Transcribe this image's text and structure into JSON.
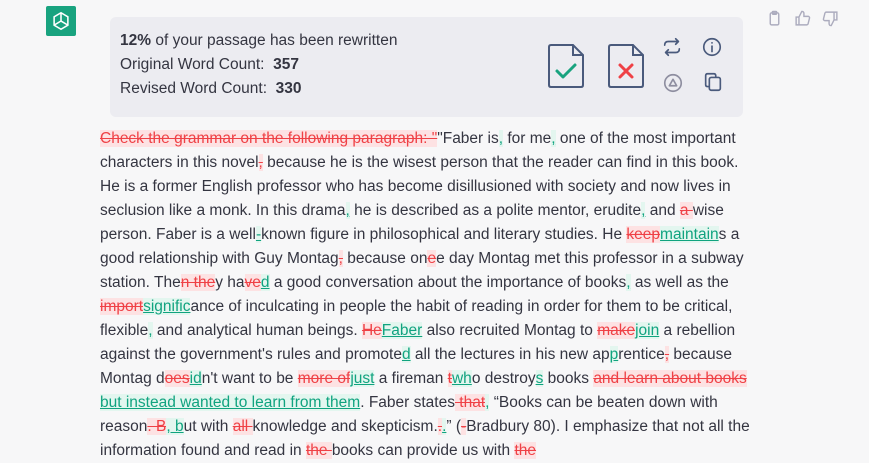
{
  "stats": {
    "percent": "12%",
    "percent_suffix": " of your passage has been rewritten",
    "original_label": "Original Word Count:",
    "original_value": "357",
    "revised_label": "Revised Word Count:",
    "revised_value": "330"
  },
  "colors": {
    "deletion": "#ef4146",
    "insertion": "#10a37f",
    "brand": "#19a37f"
  },
  "icons": [
    "chatgpt-logo-icon",
    "clipboard-icon",
    "thumbs-up-icon",
    "thumbs-down-icon",
    "accept-document-icon",
    "reject-document-icon",
    "regenerate-icon",
    "info-icon",
    "stop-icon",
    "copy-icon"
  ],
  "passage": [
    {
      "t": "del",
      "s": "Check the grammar on the following paragraph: \""
    },
    {
      "t": "txt",
      "s": "\"Faber is"
    },
    {
      "t": "ins",
      "s": ","
    },
    {
      "t": "txt",
      "s": " for me"
    },
    {
      "t": "ins",
      "s": ","
    },
    {
      "t": "txt",
      "s": " one of the most important characters in this novel"
    },
    {
      "t": "del",
      "s": ","
    },
    {
      "t": "txt",
      "s": " because he is the wisest person that the reader can find in this book. He is a former English professor who has become disillusioned with society and now lives in seclusion like a monk. In this drama"
    },
    {
      "t": "ins",
      "s": ","
    },
    {
      "t": "txt",
      "s": " he is described as a polite mentor, erudite"
    },
    {
      "t": "ins",
      "s": ","
    },
    {
      "t": "txt",
      "s": " and "
    },
    {
      "t": "del",
      "s": "a "
    },
    {
      "t": "txt",
      "s": "wise person. Faber is a well"
    },
    {
      "t": "ins",
      "s": "-"
    },
    {
      "t": "txt",
      "s": "known figure in philosophical and literary studies. He "
    },
    {
      "t": "del",
      "s": "keep"
    },
    {
      "t": "ins",
      "s": "maintain"
    },
    {
      "t": "txt",
      "s": "s a good relationship with Guy Montag"
    },
    {
      "t": "del",
      "s": ","
    },
    {
      "t": "txt",
      "s": " because on"
    },
    {
      "t": "del",
      "s": "e"
    },
    {
      "t": "txt",
      "s": "e day Montag met this professor in a subway station. The"
    },
    {
      "t": "del",
      "s": "n the"
    },
    {
      "t": "txt",
      "s": "y ha"
    },
    {
      "t": "del",
      "s": "ve"
    },
    {
      "t": "ins",
      "s": "d"
    },
    {
      "t": "txt",
      "s": " a good conversation about the importance of books"
    },
    {
      "t": "ins",
      "s": ","
    },
    {
      "t": "txt",
      "s": " as well as the "
    },
    {
      "t": "del",
      "s": "import"
    },
    {
      "t": "ins",
      "s": "signific"
    },
    {
      "t": "txt",
      "s": "ance of inculcating in people the habit of reading in order for them to be critical, flexible"
    },
    {
      "t": "ins",
      "s": ","
    },
    {
      "t": "txt",
      "s": " and analytical human beings. "
    },
    {
      "t": "del",
      "s": "He"
    },
    {
      "t": "ins",
      "s": "Faber"
    },
    {
      "t": "txt",
      "s": " also recruited Montag to "
    },
    {
      "t": "del",
      "s": "make"
    },
    {
      "t": "ins",
      "s": "join"
    },
    {
      "t": "txt",
      "s": " a rebellion against the government's rules and promote"
    },
    {
      "t": "ins",
      "s": "d"
    },
    {
      "t": "txt",
      "s": " all the lectures in his new ap"
    },
    {
      "t": "ins",
      "s": "p"
    },
    {
      "t": "txt",
      "s": "rentice"
    },
    {
      "t": "del",
      "s": ","
    },
    {
      "t": "txt",
      "s": " because Montag d"
    },
    {
      "t": "del",
      "s": "oes"
    },
    {
      "t": "ins",
      "s": "id"
    },
    {
      "t": "txt",
      "s": "n't want to be "
    },
    {
      "t": "del",
      "s": "more of"
    },
    {
      "t": "ins",
      "s": "just"
    },
    {
      "t": "txt",
      "s": " a fireman "
    },
    {
      "t": "del",
      "s": "t"
    },
    {
      "t": "ins",
      "s": "wh"
    },
    {
      "t": "txt",
      "s": "o destroy"
    },
    {
      "t": "ins",
      "s": "s"
    },
    {
      "t": "txt",
      "s": " books "
    },
    {
      "t": "del",
      "s": "and learn about books"
    },
    {
      "t": "ins",
      "s": " but instead wanted to learn from them"
    },
    {
      "t": "txt",
      "s": ". Faber states"
    },
    {
      "t": "del",
      "s": " that"
    },
    {
      "t": "ins",
      "s": ","
    },
    {
      "t": "txt",
      "s": " “Books can be beaten down with reason"
    },
    {
      "t": "del",
      "s": ". B"
    },
    {
      "t": "ins",
      "s": ", b"
    },
    {
      "t": "txt",
      "s": "ut with "
    },
    {
      "t": "del",
      "s": "all "
    },
    {
      "t": "txt",
      "s": "knowledge and skepticism."
    },
    {
      "t": "del",
      "s": "."
    },
    {
      "t": "ins",
      "s": "."
    },
    {
      "t": "txt",
      "s": "” ("
    },
    {
      "t": "del",
      "s": "-"
    },
    {
      "t": "txt",
      "s": "Bradbury 80). I emphasize that not all the information found and read in "
    },
    {
      "t": "del",
      "s": "the "
    },
    {
      "t": "txt",
      "s": "books can provide us with "
    },
    {
      "t": "del",
      "s": "the"
    }
  ]
}
